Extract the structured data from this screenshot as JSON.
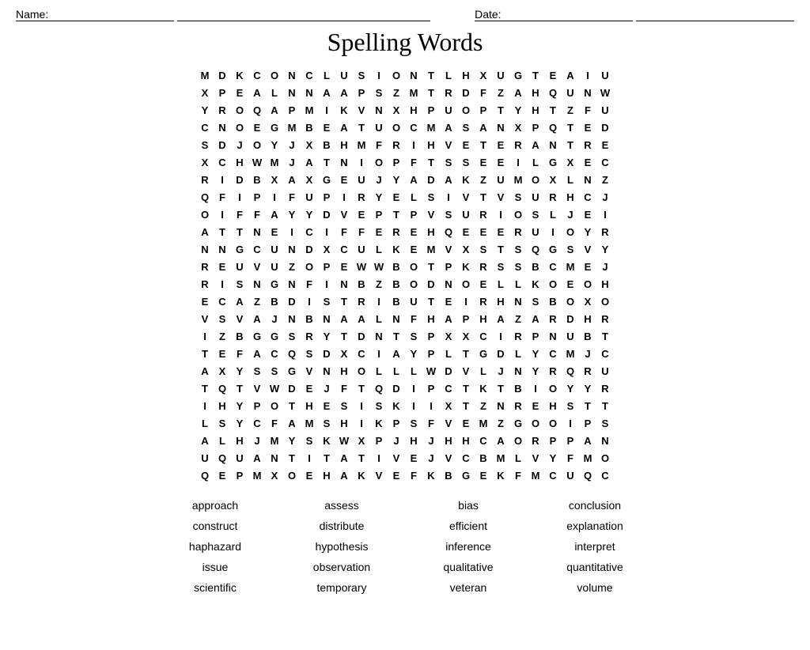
{
  "header": {
    "name_label": "Name:",
    "date_label": "Date:"
  },
  "title": "Spelling Words",
  "grid_rows": [
    [
      "M",
      "D",
      "K",
      "C",
      "O",
      "N",
      "C",
      "L",
      "U",
      "S",
      "I",
      "O",
      "N",
      "T",
      "L",
      "H",
      "X",
      "U",
      "G",
      "T",
      "E",
      "A",
      "I",
      "U"
    ],
    [
      "X",
      "P",
      "E",
      "A",
      "L",
      "N",
      "N",
      "A",
      "A",
      "P",
      "S",
      "Z",
      "M",
      "T",
      "R",
      "D",
      "F",
      "Z",
      "A",
      "H",
      "Q",
      "U",
      "N",
      "W"
    ],
    [
      "Y",
      "R",
      "O",
      "Q",
      "A",
      "P",
      "M",
      "I",
      "K",
      "V",
      "N",
      "X",
      "H",
      "P",
      "U",
      "O",
      "P",
      "T",
      "Y",
      "H",
      "T",
      "Z",
      "F",
      "U"
    ],
    [
      "C",
      "N",
      "O",
      "E",
      "G",
      "M",
      "B",
      "E",
      "A",
      "T",
      "U",
      "O",
      "C",
      "M",
      "A",
      "S",
      "A",
      "N",
      "X",
      "P",
      "Q",
      "T",
      "E",
      "D"
    ],
    [
      "S",
      "D",
      "J",
      "O",
      "Y",
      "J",
      "X",
      "B",
      "H",
      "M",
      "F",
      "R",
      "I",
      "H",
      "V",
      "E",
      "T",
      "E",
      "R",
      "A",
      "N",
      "T",
      "R",
      "E"
    ],
    [
      "X",
      "C",
      "H",
      "W",
      "M",
      "J",
      "A",
      "T",
      "N",
      "I",
      "O",
      "P",
      "F",
      "T",
      "S",
      "S",
      "E",
      "E",
      "I",
      "L",
      "G",
      "X",
      "E",
      "C"
    ],
    [
      "R",
      "I",
      "D",
      "B",
      "X",
      "A",
      "X",
      "G",
      "E",
      "U",
      "J",
      "Y",
      "A",
      "D",
      "A",
      "K",
      "Z",
      "U",
      "M",
      "O",
      "X",
      "L",
      "N",
      "Z"
    ],
    [
      "Q",
      "F",
      "I",
      "P",
      "I",
      "F",
      "U",
      "P",
      "I",
      "R",
      "Y",
      "E",
      "L",
      "S",
      "I",
      "V",
      "T",
      "V",
      "S",
      "U",
      "R",
      "H",
      "C",
      "J"
    ],
    [
      "O",
      "I",
      "F",
      "F",
      "A",
      "Y",
      "Y",
      "D",
      "V",
      "E",
      "P",
      "T",
      "P",
      "V",
      "S",
      "U",
      "R",
      "I",
      "O",
      "S",
      "L",
      "J",
      "E",
      "I"
    ],
    [
      "A",
      "T",
      "T",
      "N",
      "E",
      "I",
      "C",
      "I",
      "F",
      "F",
      "E",
      "R",
      "E",
      "H",
      "Q",
      "E",
      "E",
      "E",
      "R",
      "U",
      "I",
      "O",
      "Y",
      "R"
    ],
    [
      "N",
      "N",
      "G",
      "C",
      "U",
      "N",
      "D",
      "X",
      "C",
      "U",
      "L",
      "K",
      "E",
      "M",
      "V",
      "X",
      "S",
      "T",
      "S",
      "Q",
      "G",
      "S",
      "V",
      "Y"
    ],
    [
      "R",
      "E",
      "U",
      "V",
      "U",
      "Z",
      "O",
      "P",
      "E",
      "W",
      "W",
      "B",
      "O",
      "T",
      "P",
      "K",
      "R",
      "S",
      "S",
      "B",
      "C",
      "M",
      "E",
      "J"
    ],
    [
      "R",
      "I",
      "S",
      "N",
      "G",
      "N",
      "F",
      "I",
      "N",
      "B",
      "Z",
      "B",
      "O",
      "D",
      "N",
      "O",
      "E",
      "L",
      "L",
      "K",
      "O",
      "E",
      "O",
      "H"
    ],
    [
      "E",
      "C",
      "A",
      "Z",
      "B",
      "D",
      "I",
      "S",
      "T",
      "R",
      "I",
      "B",
      "U",
      "T",
      "E",
      "I",
      "R",
      "H",
      "N",
      "S",
      "B",
      "O",
      "X",
      "O"
    ],
    [
      "V",
      "S",
      "V",
      "A",
      "J",
      "N",
      "B",
      "N",
      "A",
      "A",
      "L",
      "N",
      "F",
      "H",
      "A",
      "P",
      "H",
      "A",
      "Z",
      "A",
      "R",
      "D",
      "H",
      "R"
    ],
    [
      "I",
      "Z",
      "B",
      "G",
      "G",
      "S",
      "R",
      "Y",
      "T",
      "D",
      "N",
      "T",
      "S",
      "P",
      "X",
      "X",
      "C",
      "I",
      "R",
      "P",
      "N",
      "U",
      "B",
      "T"
    ],
    [
      "T",
      "E",
      "F",
      "A",
      "C",
      "Q",
      "S",
      "D",
      "X",
      "C",
      "I",
      "A",
      "Y",
      "P",
      "L",
      "T",
      "G",
      "D",
      "L",
      "Y",
      "C",
      "M",
      "J",
      "C"
    ],
    [
      "A",
      "X",
      "Y",
      "S",
      "S",
      "G",
      "V",
      "N",
      "H",
      "O",
      "L",
      "L",
      "L",
      "W",
      "D",
      "V",
      "L",
      "J",
      "N",
      "Y",
      "R",
      "Q",
      "R",
      "U"
    ],
    [
      "T",
      "Q",
      "T",
      "V",
      "W",
      "D",
      "E",
      "J",
      "F",
      "T",
      "Q",
      "D",
      "I",
      "P",
      "C",
      "T",
      "K",
      "T",
      "B",
      "I",
      "O",
      "Y",
      "Y",
      "R"
    ],
    [
      "I",
      "H",
      "Y",
      "P",
      "O",
      "T",
      "H",
      "E",
      "S",
      "I",
      "S",
      "K",
      "I",
      "I",
      "X",
      "T",
      "Z",
      "N",
      "R",
      "E",
      "H",
      "S",
      "T",
      "T"
    ],
    [
      "L",
      "S",
      "Y",
      "C",
      "F",
      "A",
      "M",
      "S",
      "H",
      "I",
      "K",
      "P",
      "S",
      "F",
      "V",
      "E",
      "M",
      "Z",
      "G",
      "O",
      "O",
      "I",
      "P",
      "S"
    ],
    [
      "A",
      "L",
      "H",
      "J",
      "M",
      "Y",
      "S",
      "K",
      "W",
      "X",
      "P",
      "J",
      "H",
      "J",
      "H",
      "H",
      "C",
      "A",
      "O",
      "R",
      "P",
      "P",
      "A",
      "N"
    ],
    [
      "U",
      "Q",
      "U",
      "A",
      "N",
      "T",
      "I",
      "T",
      "A",
      "T",
      "I",
      "V",
      "E",
      "J",
      "V",
      "C",
      "B",
      "M",
      "L",
      "V",
      "Y",
      "F",
      "M",
      "O"
    ],
    [
      "Q",
      "E",
      "P",
      "M",
      "X",
      "O",
      "E",
      "H",
      "A",
      "K",
      "V",
      "E",
      "F",
      "K",
      "B",
      "G",
      "E",
      "K",
      "F",
      "M",
      "C",
      "U",
      "Q",
      "C"
    ]
  ],
  "words": [
    "approach",
    "assess",
    "bias",
    "conclusion",
    "construct",
    "distribute",
    "efficient",
    "explanation",
    "haphazard",
    "hypothesis",
    "inference",
    "interpret",
    "issue",
    "observation",
    "qualitative",
    "quantitative",
    "scientific",
    "temporary",
    "veteran",
    "volume"
  ]
}
